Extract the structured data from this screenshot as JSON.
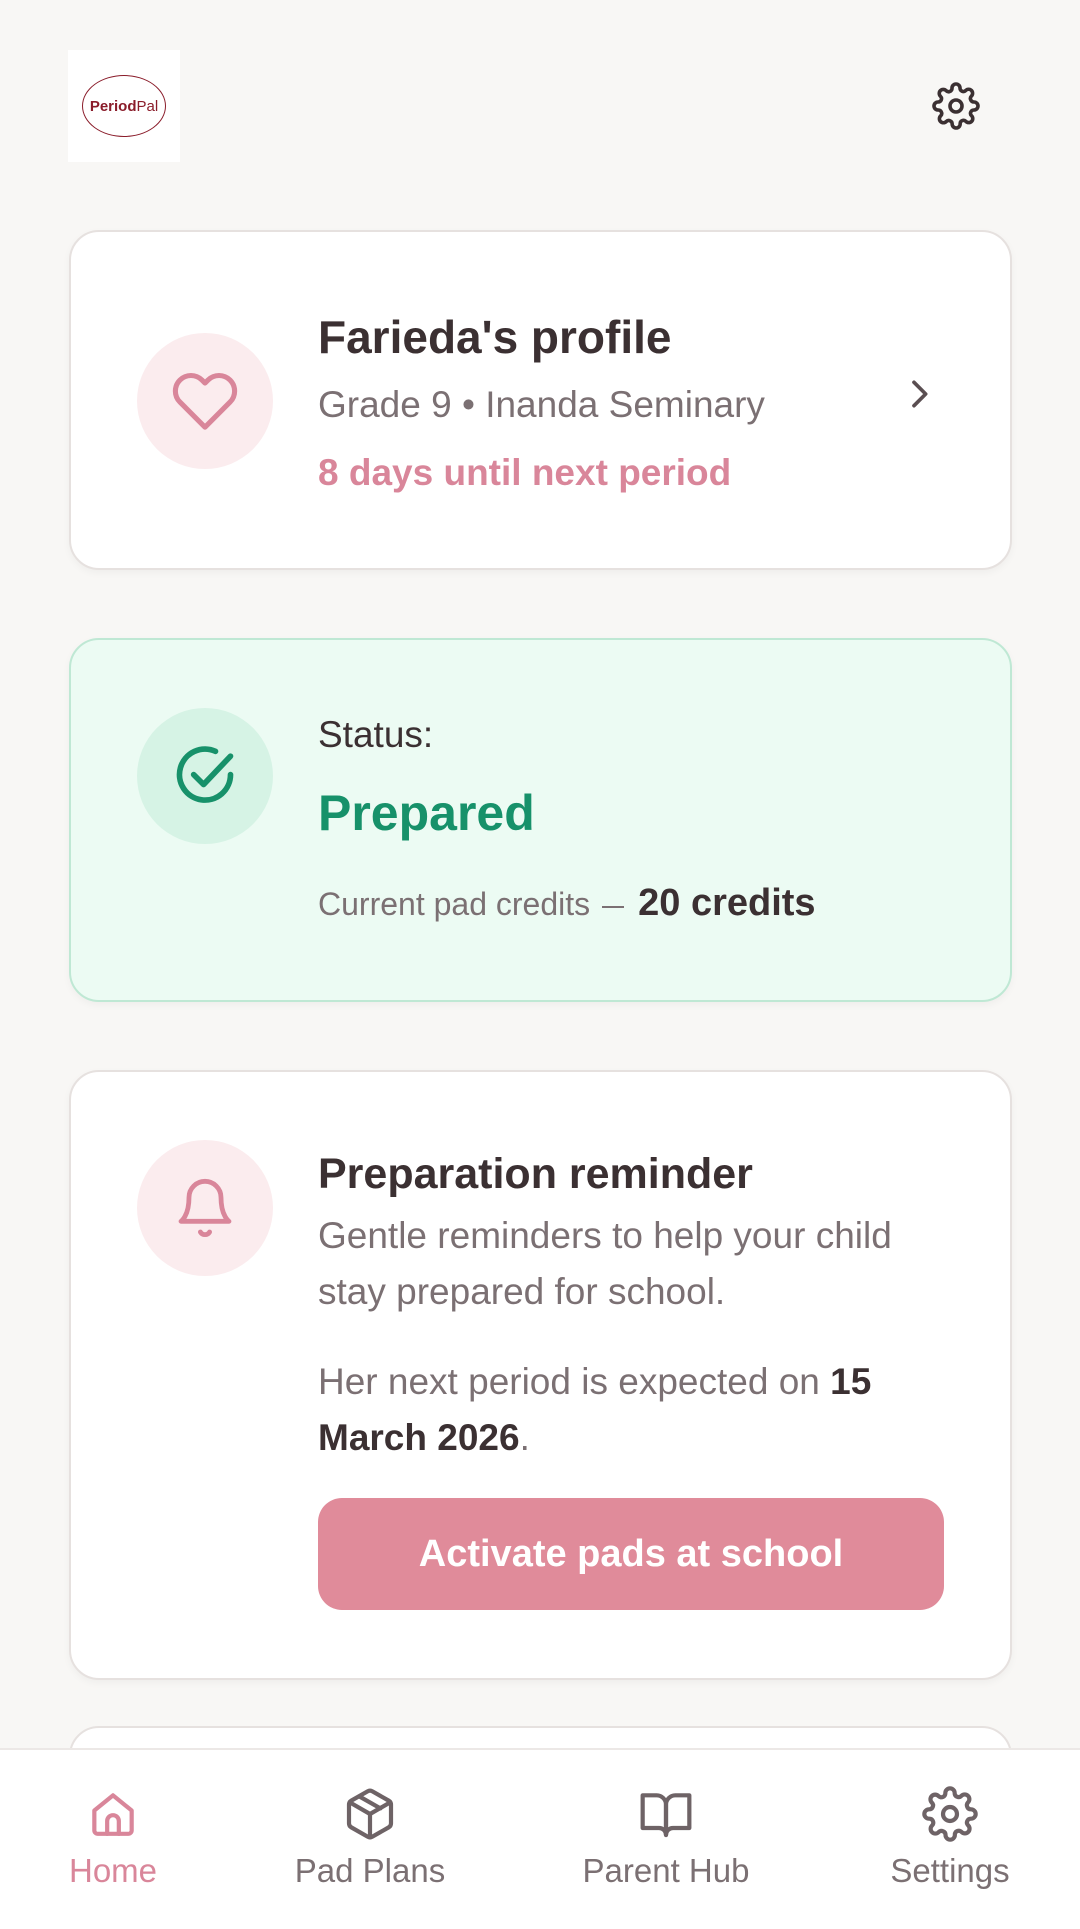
{
  "header": {
    "logo_text_bold": "Period",
    "logo_text_light": "Pal"
  },
  "profile": {
    "title": "Farieda's profile",
    "details": "Grade 9 • Inanda Seminary",
    "next_period": "8 days until next period"
  },
  "status": {
    "label": "Status:",
    "value": "Prepared",
    "credits_label": "Current pad credits",
    "credits_value": "20 credits"
  },
  "reminder": {
    "title": "Preparation reminder",
    "description": "Gentle reminders to help your child stay prepared for school.",
    "expected_prefix": "Her next period is expected on ",
    "expected_date": "15 March 2026",
    "expected_suffix": ".",
    "button_label": "Activate pads at school"
  },
  "nav": [
    {
      "label": "Home",
      "icon": "home-icon",
      "active": true
    },
    {
      "label": "Pad Plans",
      "icon": "box-icon",
      "active": false
    },
    {
      "label": "Parent Hub",
      "icon": "book-icon",
      "active": false
    },
    {
      "label": "Settings",
      "icon": "gear-icon",
      "active": false
    }
  ],
  "colors": {
    "accent_pink": "#e08b9a",
    "accent_green": "#17916a",
    "background": "#f8f7f5"
  }
}
